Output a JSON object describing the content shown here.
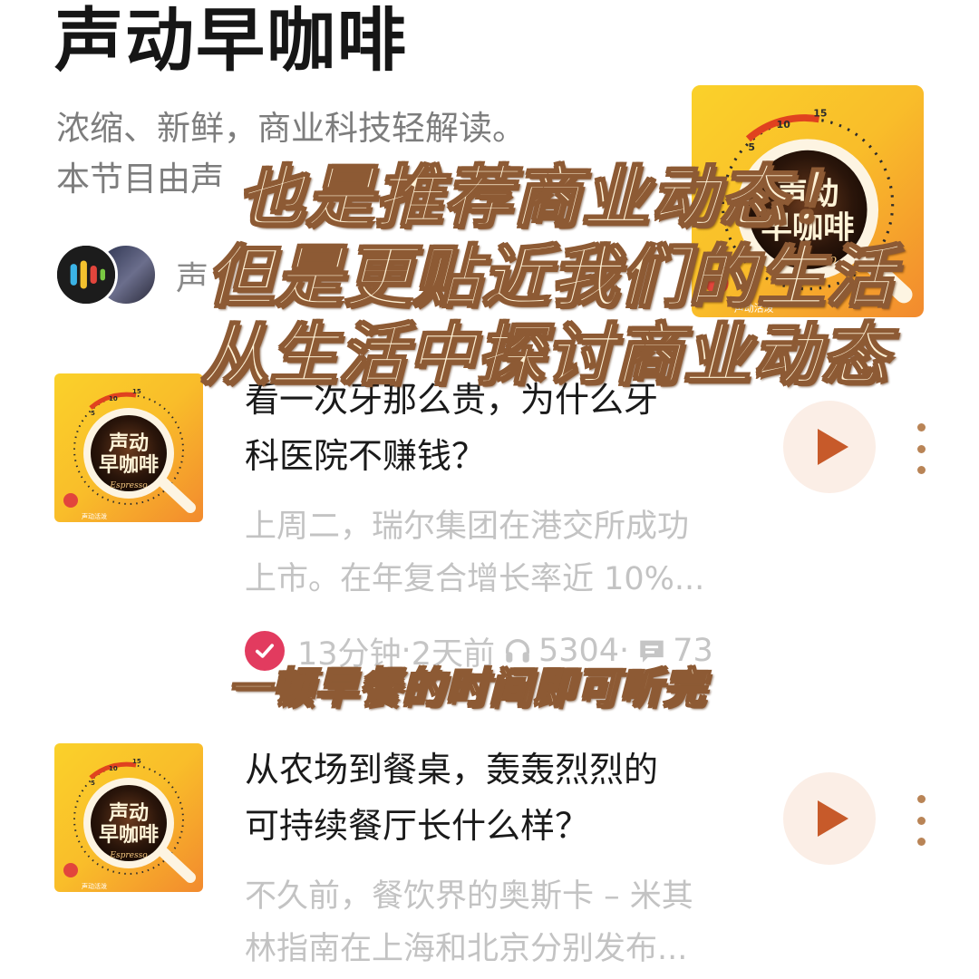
{
  "show": {
    "title": "声动早咖啡",
    "description_line1": "浓缩、新鲜，商业科技轻解读。",
    "description_line2": "本节目由声",
    "creators_text": "声",
    "cover": {
      "logo_text_line1": "声动",
      "logo_text_line2": "早咖啡",
      "brand_label": "声动活泼",
      "espresso_label": "Espresso",
      "timer_ticks": [
        "5",
        "10",
        "15"
      ]
    }
  },
  "overlay_caption": {
    "line1": "也是推荐商业动态！",
    "line2": "但是更贴近我们的生活",
    "line3": "从生活中探讨商业动态",
    "line4": "一顿早餐的时间即可听完"
  },
  "episodes": [
    {
      "title_line1": "看一次牙那么贵，为什么牙",
      "title_line2": "科医院不赚钱？",
      "summary_line1": "上周二，瑞尔集团在港交所成功",
      "summary_line2": "上市。在年复合增长率近 10%...",
      "duration": "13分钟",
      "published": "2天前",
      "plays": "5304",
      "comments": "73"
    },
    {
      "title_line1": "从农场到餐桌，轰轰烈烈的",
      "title_line2": "可持续餐厅长什么样？",
      "summary_line1": "不久前，餐饮界的奥斯卡 – 米其",
      "summary_line2": "林指南在上海和北京分别发布..."
    }
  ],
  "colors": {
    "accent_play": "#c75a2a",
    "play_bg": "#fbeee6",
    "cover_yellow": "#f9c31d",
    "cover_orange": "#f28a2e",
    "completed_badge": "#e23b5f",
    "overlay_fill": "#fff2d6",
    "overlay_stroke": "#8d5a34"
  },
  "icons": {
    "play": "play-icon",
    "more": "more-vertical-icon",
    "completed": "check-circle-icon",
    "plays": "headphones-icon",
    "comments": "comment-icon"
  }
}
